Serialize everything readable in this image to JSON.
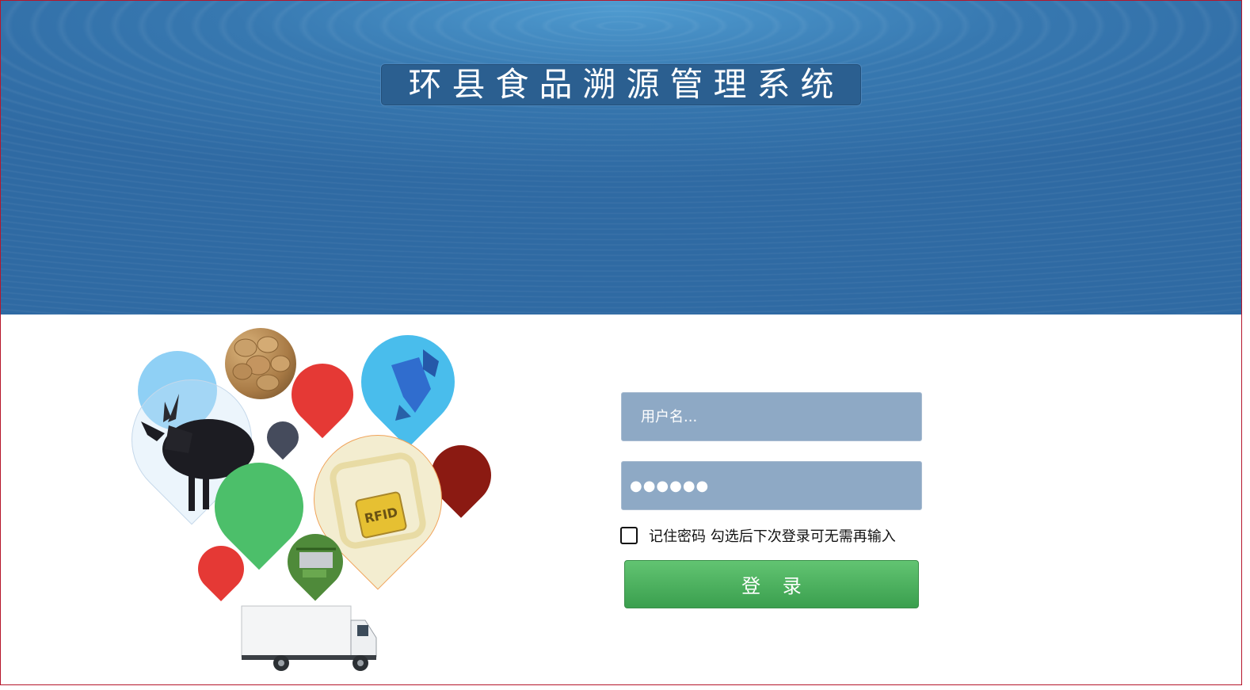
{
  "header": {
    "title": "环县食品溯源管理系统"
  },
  "login": {
    "username_placeholder": "用户名...",
    "password_value": "●●●●●●",
    "remember_label": "记住密码 勾选后下次登录可无需再输入",
    "submit_label": "登 录"
  },
  "illustration": {
    "rfid_label": "RFID"
  },
  "colors": {
    "banner": "#2f6aa3",
    "field_bg": "#8ea9c5",
    "button": "#4caf5c",
    "border": "#b5162b"
  }
}
